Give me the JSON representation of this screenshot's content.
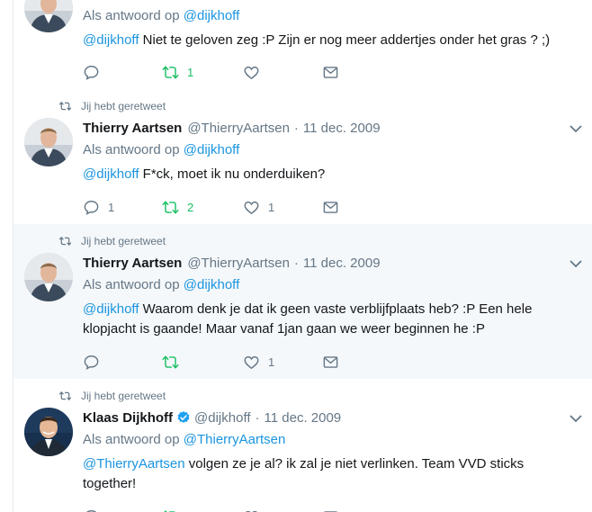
{
  "colors": {
    "link": "#1b95e0",
    "muted": "#657786",
    "retweet_green": "#17bf63",
    "highlight_bg": "#f5f8fa",
    "verified_blue": "#1da1f2"
  },
  "tweets": [
    {
      "reply_prefix": "Als antwoord op",
      "reply_to": "@dijkhoff",
      "mention": "@dijkhoff",
      "text": " Niet te geloven zeg :P Zijn er nog meer addertjes onder het gras ? ;)",
      "replies": "",
      "retweets": "1",
      "likes": ""
    },
    {
      "context": "Jij hebt geretweet",
      "name": "Thierry Aartsen",
      "handle": "@ThierryAartsen",
      "separator": "·",
      "date": "11 dec. 2009",
      "reply_prefix": "Als antwoord op",
      "reply_to": "@dijkhoff",
      "mention": "@dijkhoff",
      "text": " F*ck, moet ik nu onderduiken?",
      "replies": "1",
      "retweets": "2",
      "likes": "1"
    },
    {
      "context": "Jij hebt geretweet",
      "name": "Thierry Aartsen",
      "handle": "@ThierryAartsen",
      "separator": "·",
      "date": "11 dec. 2009",
      "reply_prefix": "Als antwoord op",
      "reply_to": "@dijkhoff",
      "mention": "@dijkhoff",
      "text_line1": " Waarom denk je dat ik geen vaste verblijfplaats heb? :P Een hele",
      "text_line2": "klopjacht is gaande! Maar vanaf 1jan gaan we weer beginnen he :P",
      "replies": "",
      "retweets": "",
      "likes": "1"
    },
    {
      "context": "Jij hebt geretweet",
      "name": "Klaas Dijkhoff",
      "handle": "@dijkhoff",
      "separator": "·",
      "date": "11 dec. 2009",
      "reply_prefix": "Als antwoord op",
      "reply_to": "@ThierryAartsen",
      "mention": "@ThierryAartsen",
      "text_line1": " volgen ze je al? ik zal je niet verlinken. Team VVD sticks",
      "text_line2": "together!"
    }
  ]
}
